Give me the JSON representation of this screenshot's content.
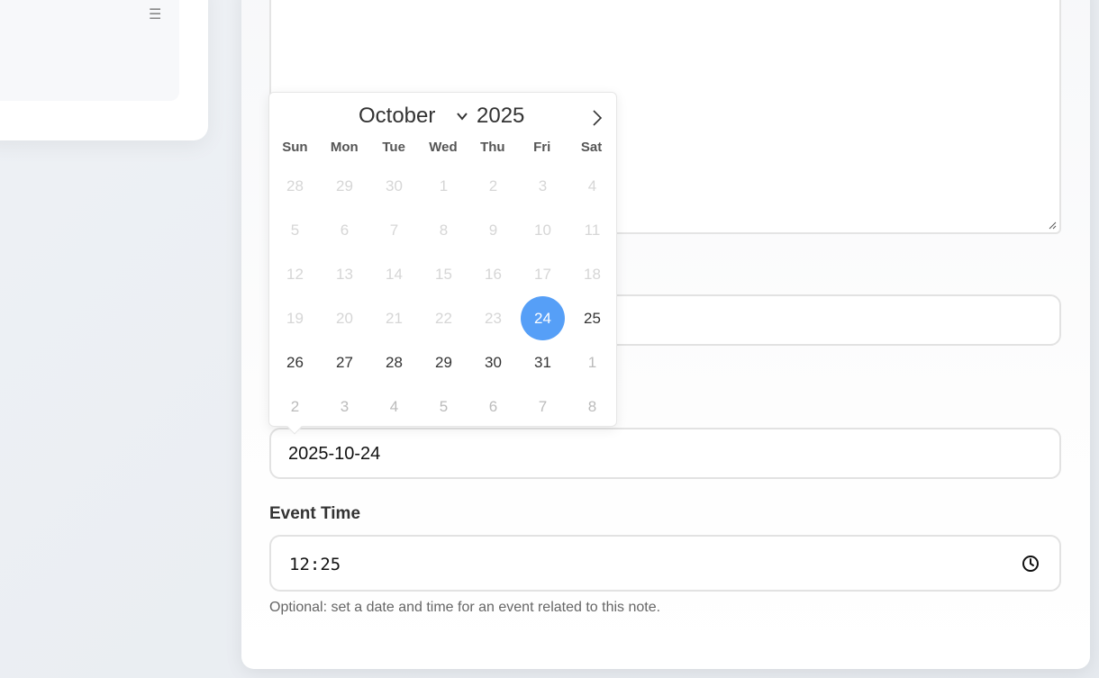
{
  "sidebar": {
    "menu_icon": "hamburger-icon"
  },
  "event_date": {
    "value": "2025-10-24"
  },
  "event_time": {
    "label": "Event Time",
    "value": "12:25",
    "icon": "clock-icon"
  },
  "helper_text": "Optional: set a date and time for an event related to this note.",
  "calendar": {
    "month": "October",
    "year": "2025",
    "next_icon": "chevron-right-icon",
    "weekdays": [
      "Sun",
      "Mon",
      "Tue",
      "Wed",
      "Thu",
      "Fri",
      "Sat"
    ],
    "weeks": [
      [
        {
          "d": "28",
          "s": "dim"
        },
        {
          "d": "29",
          "s": "dim"
        },
        {
          "d": "30",
          "s": "dim"
        },
        {
          "d": "1",
          "s": "dim"
        },
        {
          "d": "2",
          "s": "dim"
        },
        {
          "d": "3",
          "s": "dim"
        },
        {
          "d": "4",
          "s": "dim"
        }
      ],
      [
        {
          "d": "5",
          "s": "dim"
        },
        {
          "d": "6",
          "s": "dim"
        },
        {
          "d": "7",
          "s": "dim"
        },
        {
          "d": "8",
          "s": "dim"
        },
        {
          "d": "9",
          "s": "dim"
        },
        {
          "d": "10",
          "s": "dim"
        },
        {
          "d": "11",
          "s": "dim"
        }
      ],
      [
        {
          "d": "12",
          "s": "dim"
        },
        {
          "d": "13",
          "s": "dim"
        },
        {
          "d": "14",
          "s": "dim"
        },
        {
          "d": "15",
          "s": "dim"
        },
        {
          "d": "16",
          "s": "dim"
        },
        {
          "d": "17",
          "s": "dim"
        },
        {
          "d": "18",
          "s": "dim"
        }
      ],
      [
        {
          "d": "19",
          "s": "dim"
        },
        {
          "d": "20",
          "s": "dim"
        },
        {
          "d": "21",
          "s": "dim"
        },
        {
          "d": "22",
          "s": "dim"
        },
        {
          "d": "23",
          "s": "dim"
        },
        {
          "d": "24",
          "s": "selected"
        },
        {
          "d": "25",
          "s": "normal"
        }
      ],
      [
        {
          "d": "26",
          "s": "normal"
        },
        {
          "d": "27",
          "s": "normal"
        },
        {
          "d": "28",
          "s": "normal"
        },
        {
          "d": "29",
          "s": "normal"
        },
        {
          "d": "30",
          "s": "normal"
        },
        {
          "d": "31",
          "s": "normal"
        },
        {
          "d": "1",
          "s": "other"
        }
      ],
      [
        {
          "d": "2",
          "s": "other"
        },
        {
          "d": "3",
          "s": "other"
        },
        {
          "d": "4",
          "s": "other"
        },
        {
          "d": "5",
          "s": "other"
        },
        {
          "d": "6",
          "s": "other"
        },
        {
          "d": "7",
          "s": "other"
        },
        {
          "d": "8",
          "s": "other"
        }
      ]
    ],
    "accent_color": "#569ff7"
  }
}
